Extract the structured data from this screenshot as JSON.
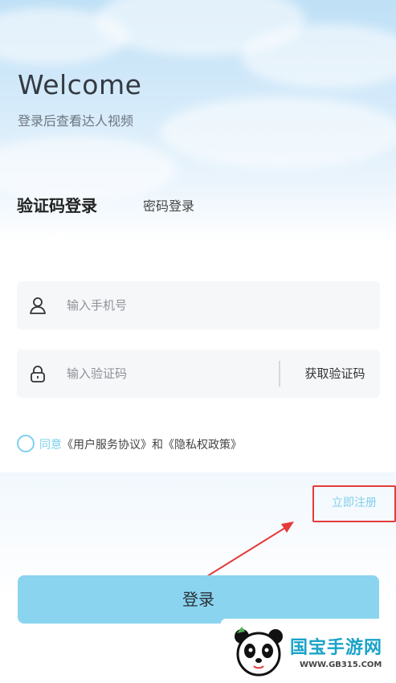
{
  "header": {
    "welcome": "Welcome",
    "subtitle": "登录后查看达人视频"
  },
  "tabs": [
    {
      "label": "验证码登录",
      "active": true
    },
    {
      "label": "密码登录",
      "active": false
    }
  ],
  "form": {
    "phone_placeholder": "输入手机号",
    "code_placeholder": "输入验证码",
    "get_code_label": "获取验证码"
  },
  "agreement": {
    "prefix": "同意",
    "text": "《用户服务协议》和《隐私权政策》",
    "checked": false
  },
  "register_label": "立即注册",
  "login_label": "登录",
  "watermark": {
    "brand": "国宝手游网",
    "url": "WWW.GB315.COM"
  },
  "colors": {
    "accent": "#7fd0ec",
    "login_button": "#8ad4f0",
    "highlight_box": "#e53b3b"
  }
}
